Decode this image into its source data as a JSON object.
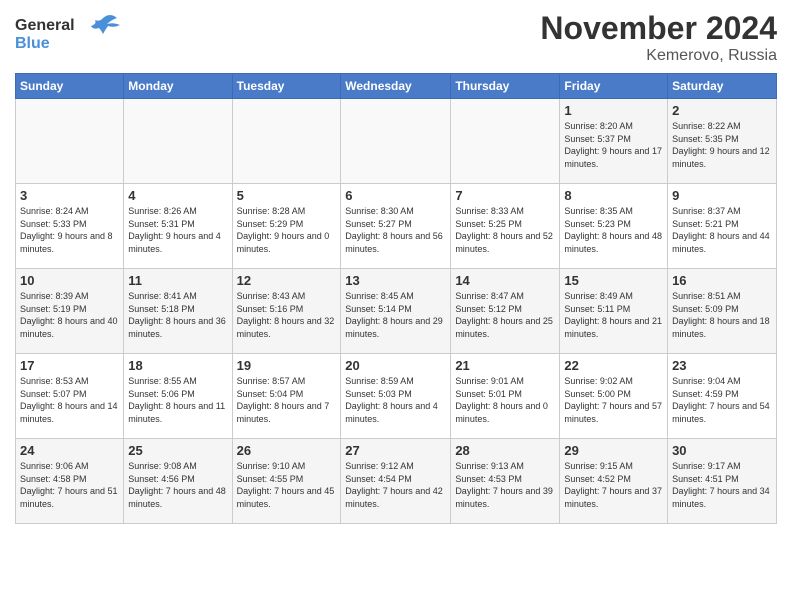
{
  "header": {
    "logo_line1": "General",
    "logo_line2": "Blue",
    "month": "November 2024",
    "location": "Kemerovo, Russia"
  },
  "weekdays": [
    "Sunday",
    "Monday",
    "Tuesday",
    "Wednesday",
    "Thursday",
    "Friday",
    "Saturday"
  ],
  "weeks": [
    [
      {
        "day": "",
        "info": ""
      },
      {
        "day": "",
        "info": ""
      },
      {
        "day": "",
        "info": ""
      },
      {
        "day": "",
        "info": ""
      },
      {
        "day": "",
        "info": ""
      },
      {
        "day": "1",
        "info": "Sunrise: 8:20 AM\nSunset: 5:37 PM\nDaylight: 9 hours and 17 minutes."
      },
      {
        "day": "2",
        "info": "Sunrise: 8:22 AM\nSunset: 5:35 PM\nDaylight: 9 hours and 12 minutes."
      }
    ],
    [
      {
        "day": "3",
        "info": "Sunrise: 8:24 AM\nSunset: 5:33 PM\nDaylight: 9 hours and 8 minutes."
      },
      {
        "day": "4",
        "info": "Sunrise: 8:26 AM\nSunset: 5:31 PM\nDaylight: 9 hours and 4 minutes."
      },
      {
        "day": "5",
        "info": "Sunrise: 8:28 AM\nSunset: 5:29 PM\nDaylight: 9 hours and 0 minutes."
      },
      {
        "day": "6",
        "info": "Sunrise: 8:30 AM\nSunset: 5:27 PM\nDaylight: 8 hours and 56 minutes."
      },
      {
        "day": "7",
        "info": "Sunrise: 8:33 AM\nSunset: 5:25 PM\nDaylight: 8 hours and 52 minutes."
      },
      {
        "day": "8",
        "info": "Sunrise: 8:35 AM\nSunset: 5:23 PM\nDaylight: 8 hours and 48 minutes."
      },
      {
        "day": "9",
        "info": "Sunrise: 8:37 AM\nSunset: 5:21 PM\nDaylight: 8 hours and 44 minutes."
      }
    ],
    [
      {
        "day": "10",
        "info": "Sunrise: 8:39 AM\nSunset: 5:19 PM\nDaylight: 8 hours and 40 minutes."
      },
      {
        "day": "11",
        "info": "Sunrise: 8:41 AM\nSunset: 5:18 PM\nDaylight: 8 hours and 36 minutes."
      },
      {
        "day": "12",
        "info": "Sunrise: 8:43 AM\nSunset: 5:16 PM\nDaylight: 8 hours and 32 minutes."
      },
      {
        "day": "13",
        "info": "Sunrise: 8:45 AM\nSunset: 5:14 PM\nDaylight: 8 hours and 29 minutes."
      },
      {
        "day": "14",
        "info": "Sunrise: 8:47 AM\nSunset: 5:12 PM\nDaylight: 8 hours and 25 minutes."
      },
      {
        "day": "15",
        "info": "Sunrise: 8:49 AM\nSunset: 5:11 PM\nDaylight: 8 hours and 21 minutes."
      },
      {
        "day": "16",
        "info": "Sunrise: 8:51 AM\nSunset: 5:09 PM\nDaylight: 8 hours and 18 minutes."
      }
    ],
    [
      {
        "day": "17",
        "info": "Sunrise: 8:53 AM\nSunset: 5:07 PM\nDaylight: 8 hours and 14 minutes."
      },
      {
        "day": "18",
        "info": "Sunrise: 8:55 AM\nSunset: 5:06 PM\nDaylight: 8 hours and 11 minutes."
      },
      {
        "day": "19",
        "info": "Sunrise: 8:57 AM\nSunset: 5:04 PM\nDaylight: 8 hours and 7 minutes."
      },
      {
        "day": "20",
        "info": "Sunrise: 8:59 AM\nSunset: 5:03 PM\nDaylight: 8 hours and 4 minutes."
      },
      {
        "day": "21",
        "info": "Sunrise: 9:01 AM\nSunset: 5:01 PM\nDaylight: 8 hours and 0 minutes."
      },
      {
        "day": "22",
        "info": "Sunrise: 9:02 AM\nSunset: 5:00 PM\nDaylight: 7 hours and 57 minutes."
      },
      {
        "day": "23",
        "info": "Sunrise: 9:04 AM\nSunset: 4:59 PM\nDaylight: 7 hours and 54 minutes."
      }
    ],
    [
      {
        "day": "24",
        "info": "Sunrise: 9:06 AM\nSunset: 4:58 PM\nDaylight: 7 hours and 51 minutes."
      },
      {
        "day": "25",
        "info": "Sunrise: 9:08 AM\nSunset: 4:56 PM\nDaylight: 7 hours and 48 minutes."
      },
      {
        "day": "26",
        "info": "Sunrise: 9:10 AM\nSunset: 4:55 PM\nDaylight: 7 hours and 45 minutes."
      },
      {
        "day": "27",
        "info": "Sunrise: 9:12 AM\nSunset: 4:54 PM\nDaylight: 7 hours and 42 minutes."
      },
      {
        "day": "28",
        "info": "Sunrise: 9:13 AM\nSunset: 4:53 PM\nDaylight: 7 hours and 39 minutes."
      },
      {
        "day": "29",
        "info": "Sunrise: 9:15 AM\nSunset: 4:52 PM\nDaylight: 7 hours and 37 minutes."
      },
      {
        "day": "30",
        "info": "Sunrise: 9:17 AM\nSunset: 4:51 PM\nDaylight: 7 hours and 34 minutes."
      }
    ]
  ]
}
